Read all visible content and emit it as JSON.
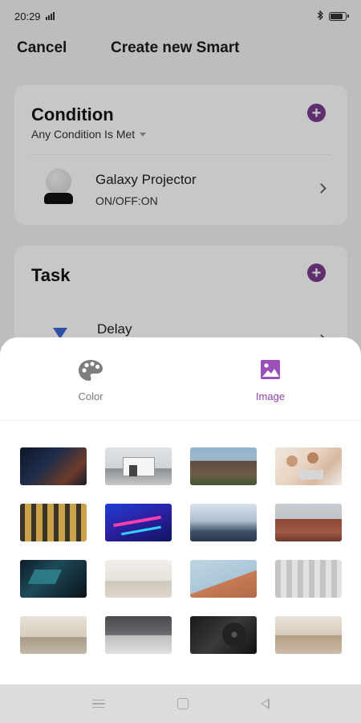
{
  "status_bar": {
    "time": "20:29",
    "icons": [
      "signal-icon",
      "bluetooth-icon",
      "battery-icon"
    ],
    "battery_level": 0.85
  },
  "header": {
    "cancel_label": "Cancel",
    "title": "Create new Smart"
  },
  "condition_card": {
    "title": "Condition",
    "subtitle": "Any Condition Is Met",
    "device": {
      "name": "Galaxy Projector",
      "state": "ON/OFF:ON"
    }
  },
  "task_card": {
    "title": "Task",
    "first_task": "Delay"
  },
  "sheet": {
    "tabs": [
      {
        "label": "Color",
        "icon": "palette-icon",
        "active": false
      },
      {
        "label": "Image",
        "icon": "image-icon",
        "active": true
      }
    ],
    "thumbnails": [
      "starry-night-sky",
      "modern-white-house",
      "row-of-townhouses",
      "family-on-sofa",
      "office-building-facade",
      "neon-blue-abstract",
      "misty-mountains",
      "old-city-rooftops",
      "dark-teal-abstract",
      "bright-bedroom",
      "building-corner-sky",
      "window-curtains",
      "living-room-interior",
      "grey-bedroom",
      "dark-vinyl-record",
      "hotel-bedroom"
    ]
  },
  "nav_bar": {
    "icons": [
      "menu-icon",
      "home-icon",
      "back-icon"
    ]
  },
  "colors": {
    "accent": "#7a3b8e",
    "tab_active": "#8e44a8",
    "delay_icon": "#3b67d4"
  }
}
